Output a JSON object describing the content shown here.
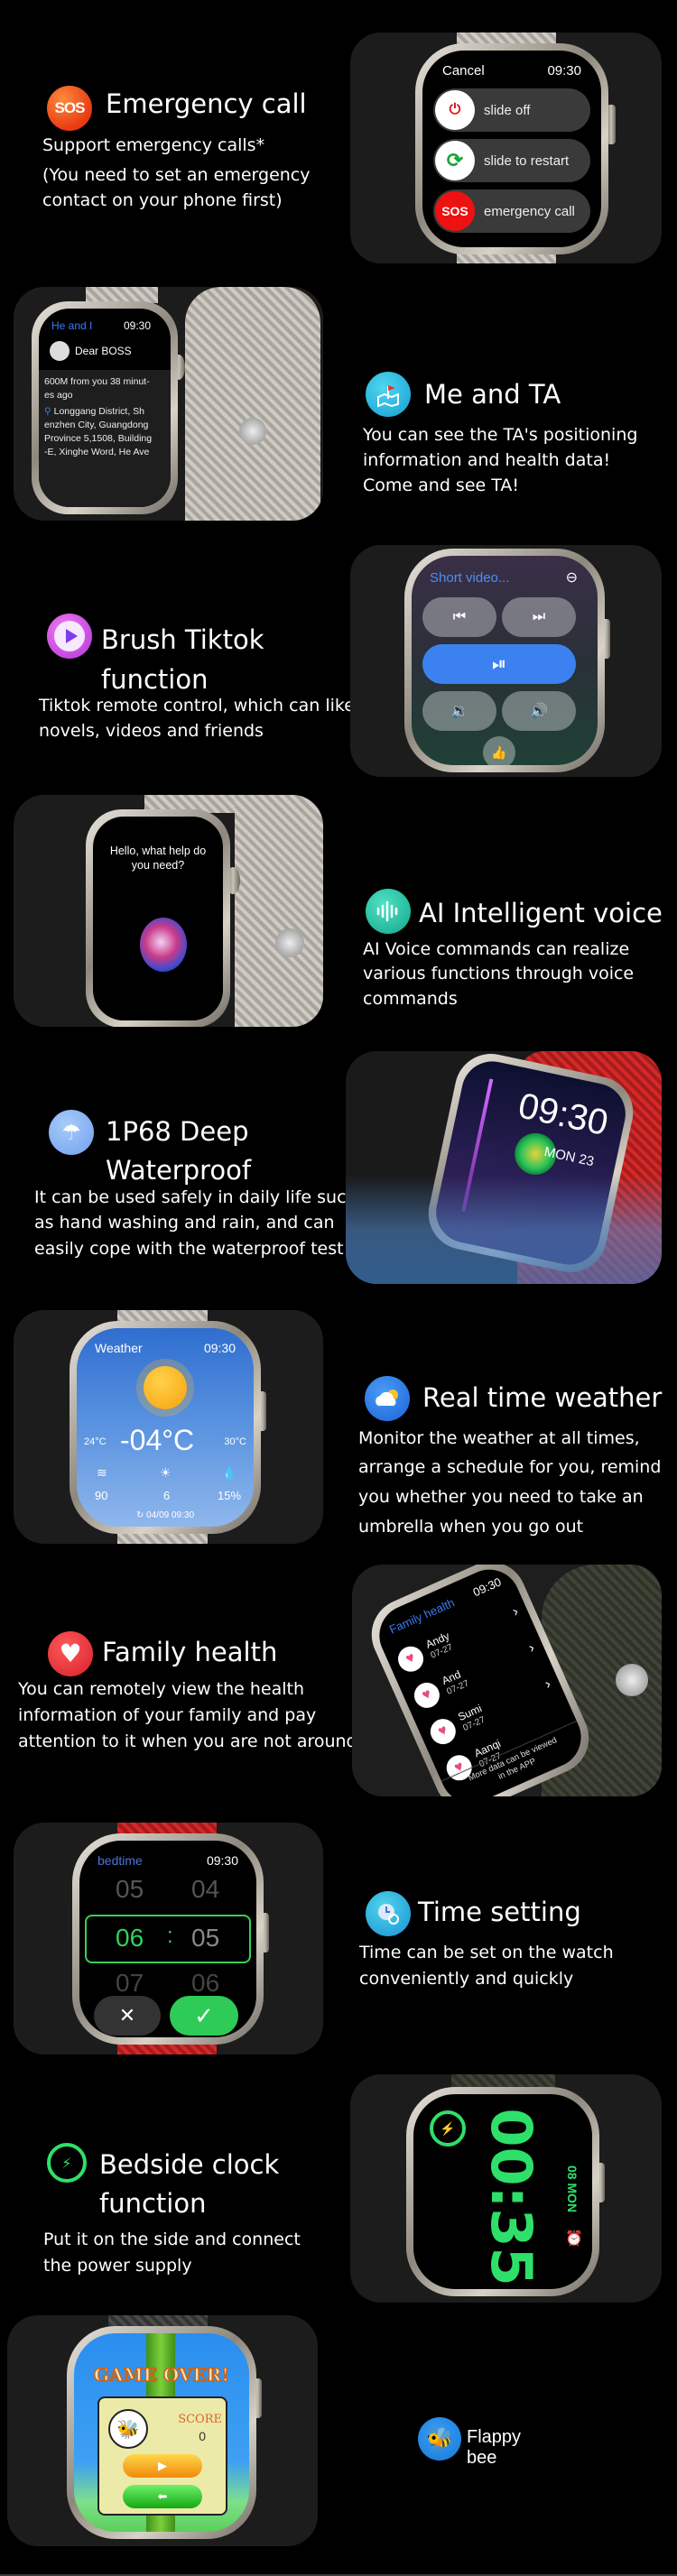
{
  "sections": {
    "emergency": {
      "icon": "sos-icon",
      "title": "Emergency call",
      "desc": [
        "Support emergency calls*",
        "(You need to set an emergency",
        "contact on your phone first)"
      ],
      "watch": {
        "cancel": "Cancel",
        "time": "09:30",
        "options": [
          {
            "icon": "power-icon",
            "label": "slide off"
          },
          {
            "icon": "restart-icon",
            "label": "slide to restart"
          },
          {
            "icon": "sos-icon",
            "knob_text": "SOS",
            "label": "emergency call"
          }
        ]
      }
    },
    "me_and_ta": {
      "icon": "map-flag-icon",
      "title": "Me and TA",
      "desc": [
        "You can see the TA's positioning",
        "information and health data!",
        "Come and see TA!"
      ],
      "watch": {
        "header": "He and I",
        "time": "09:30",
        "contact": "Dear BOSS",
        "message": [
          "600M from you 38 minut-",
          "es ago"
        ],
        "address": [
          "Longgang District, Sh",
          "enzhen City, Guangdong",
          "Province 5,1508, Building",
          "-E, Xinghe Word, He Ave"
        ]
      }
    },
    "tiktok": {
      "icon": "play-icon",
      "title": [
        "Brush Tiktok",
        "function"
      ],
      "desc": [
        "Tiktok remote control, which can like",
        "novels, videos and friends"
      ],
      "watch": {
        "header": "Short video...",
        "buttons": {
          "prev": "⏮",
          "next": "⏭",
          "play_pause": "⏯",
          "vol_down": "🔉",
          "vol_up": "🔊",
          "like": "👍"
        }
      }
    },
    "ai_voice": {
      "icon": "voice-wave-icon",
      "title": "AI Intelligent voice",
      "desc": [
        "AI Voice commands can realize",
        "various functions through voice",
        "commands"
      ],
      "watch": {
        "prompt": [
          "Hello, what help do",
          "you need?"
        ]
      }
    },
    "waterproof": {
      "icon": "umbrella-icon",
      "title": [
        "1P68 Deep",
        "Waterproof"
      ],
      "desc": [
        "It can be used safely in daily life such",
        "as hand washing and rain, and can",
        "easily cope with the waterproof test"
      ],
      "watch": {
        "time": "09:30",
        "date": "MON 23"
      }
    },
    "weather": {
      "icon": "cloud-sun-icon",
      "title": "Real time weather",
      "desc": [
        "Monitor the weather at all times,",
        "arrange a schedule for you, remind",
        "you whether you need to take an",
        "umbrella when you go out"
      ],
      "watch": {
        "header": "Weather",
        "time": "09:30",
        "temp": "-04°C",
        "low": "24°C",
        "high": "30°C",
        "stats": [
          {
            "icon": "wind-icon",
            "value": "90"
          },
          {
            "icon": "uv-icon",
            "value": "6"
          },
          {
            "icon": "humidity-icon",
            "value": "15%"
          }
        ],
        "updated": "04/09 09:30"
      }
    },
    "family_health": {
      "icon": "heart-icon",
      "title": "Family health",
      "desc": [
        "You can remotely view the health",
        "information of your family and pay",
        "attention to it when you are not around"
      ],
      "watch": {
        "header": "Family health",
        "time": "09:30",
        "members": [
          {
            "name": "Andy",
            "date": "07-27"
          },
          {
            "name": "And",
            "date": "07-27"
          },
          {
            "name": "Sumi",
            "date": "07-27"
          },
          {
            "name": "Aanqi",
            "date": "07-27"
          }
        ],
        "footer": [
          "More data can be viewed",
          "in the APP"
        ]
      }
    },
    "time_setting": {
      "icon": "clock-gear-icon",
      "title": "Time setting",
      "desc": [
        "Time can be set on the watch",
        "conveniently and quickly"
      ],
      "watch": {
        "header": "bedtime",
        "time": "09:30",
        "hours": [
          "05",
          "06",
          "07"
        ],
        "minutes": [
          "04",
          "05",
          "06"
        ],
        "separator": ":",
        "cancel": "✕",
        "confirm": "✓"
      }
    },
    "bedside": {
      "icon": "charging-icon",
      "title": [
        "Bedside clock",
        "function"
      ],
      "desc": [
        "Put it on the side and connect",
        "the power supply"
      ],
      "watch": {
        "time": "00:35",
        "date": "08 MON"
      }
    },
    "flappy": {
      "icon": "bee-icon",
      "title": "Flappy bee",
      "watch": {
        "banner": "GAME OVER!",
        "score_label": "SCORE",
        "score": "0"
      }
    }
  },
  "colors": {
    "background": "#000000",
    "panel": "#1c1c1c",
    "accent_green": "#2ee06a",
    "accent_blue": "#3b7bf0"
  }
}
